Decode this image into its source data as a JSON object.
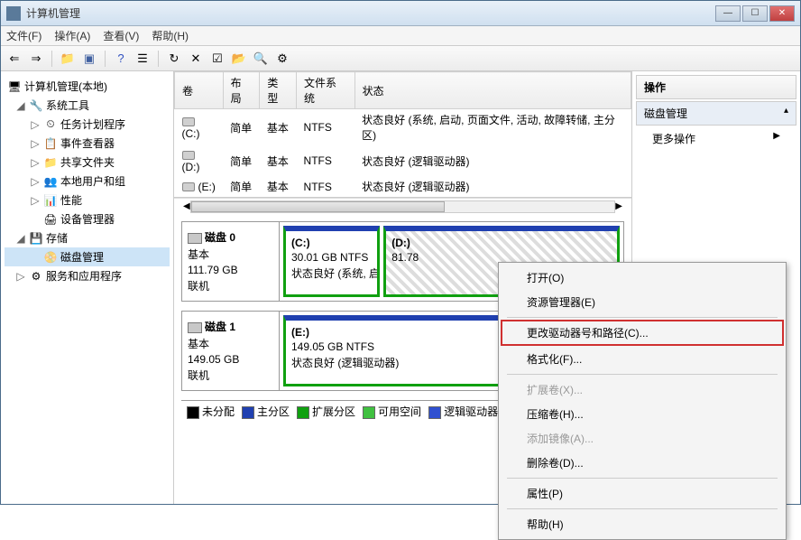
{
  "window": {
    "title": "计算机管理"
  },
  "menubar": [
    "文件(F)",
    "操作(A)",
    "查看(V)",
    "帮助(H)"
  ],
  "tree": {
    "root": "计算机管理(本地)",
    "system_tools": "系统工具",
    "task_scheduler": "任务计划程序",
    "event_viewer": "事件查看器",
    "shared_folders": "共享文件夹",
    "local_users": "本地用户和组",
    "performance": "性能",
    "device_manager": "设备管理器",
    "storage": "存储",
    "disk_management": "磁盘管理",
    "services": "服务和应用程序"
  },
  "vol_headers": {
    "volume": "卷",
    "layout": "布局",
    "type": "类型",
    "fs": "文件系统",
    "status": "状态"
  },
  "volumes": [
    {
      "name": "(C:)",
      "layout": "简单",
      "type": "基本",
      "fs": "NTFS",
      "status": "状态良好 (系统, 启动, 页面文件, 活动, 故障转储, 主分区)"
    },
    {
      "name": "(D:)",
      "layout": "简单",
      "type": "基本",
      "fs": "NTFS",
      "status": "状态良好 (逻辑驱动器)"
    },
    {
      "name": "(E:)",
      "layout": "简单",
      "type": "基本",
      "fs": "NTFS",
      "status": "状态良好 (逻辑驱动器)"
    }
  ],
  "disks": [
    {
      "label": "磁盘 0",
      "type": "基本",
      "size": "111.79 GB",
      "status": "联机",
      "parts": [
        {
          "name": "(C:)",
          "size": "30.01 GB NTFS",
          "status": "状态良好 (系统, 启动, 页面文",
          "flex": "30"
        },
        {
          "name": "(D:)",
          "size": "81.78",
          "status": "",
          "flex": "82",
          "selected": true
        }
      ]
    },
    {
      "label": "磁盘 1",
      "type": "基本",
      "size": "149.05 GB",
      "status": "联机",
      "parts": [
        {
          "name": "(E:)",
          "size": "149.05 GB NTFS",
          "status": "状态良好 (逻辑驱动器)",
          "flex": "100"
        }
      ]
    }
  ],
  "legend": {
    "unalloc": "未分配",
    "primary": "主分区",
    "extended": "扩展分区",
    "free": "可用空间",
    "logical": "逻辑驱动器"
  },
  "actions": {
    "header": "操作",
    "disk_mgmt": "磁盘管理",
    "more": "更多操作"
  },
  "context_menu": {
    "open": "打开(O)",
    "explorer": "资源管理器(E)",
    "change_letter": "更改驱动器号和路径(C)...",
    "format": "格式化(F)...",
    "extend": "扩展卷(X)...",
    "shrink": "压缩卷(H)...",
    "mirror": "添加镜像(A)...",
    "delete": "删除卷(D)...",
    "properties": "属性(P)",
    "help": "帮助(H)"
  }
}
